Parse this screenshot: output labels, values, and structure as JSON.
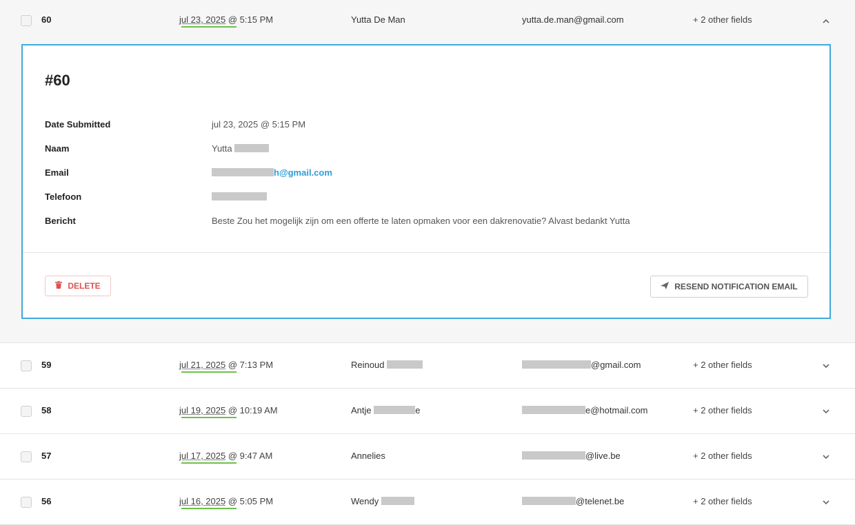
{
  "expanded": {
    "id": "60",
    "date": "jul 23, 2025",
    "time": " @ 5:15 PM",
    "name": "Yutta De Man",
    "email": "yutta.de.man@gmail.com",
    "other_fields": "+ 2 other fields",
    "detail": {
      "title": "#60",
      "fields": [
        {
          "label": "Date Submitted",
          "value": "jul 23, 2025 @ 5:15 PM"
        },
        {
          "label": "Naam",
          "value": "Yutta"
        },
        {
          "label": "Email",
          "value": "h@gmail.com"
        },
        {
          "label": "Telefoon",
          "value": ""
        },
        {
          "label": "Bericht",
          "value": "Beste Zou het mogelijk zijn om een offerte te laten opmaken voor een dakrenovatie? Alvast bedankt Yutta"
        }
      ],
      "delete_label": "DELETE",
      "resend_label": "RESEND NOTIFICATION EMAIL"
    }
  },
  "rows": [
    {
      "id": "59",
      "date": "jul 21, 2025",
      "time": " @ 7:13 PM",
      "name": "Reinoud",
      "email": "@gmail.com",
      "other_fields": "+ 2 other fields"
    },
    {
      "id": "58",
      "date": "jul 19, 2025",
      "time": " @ 10:19 AM",
      "name": "Antje",
      "name_suffix": "e",
      "email": "e@hotmail.com",
      "other_fields": "+ 2 other fields"
    },
    {
      "id": "57",
      "date": "jul 17, 2025",
      "time": " @ 9:47 AM",
      "name": "Annelies",
      "email": "@live.be",
      "other_fields": "+ 2 other fields"
    },
    {
      "id": "56",
      "date": "jul 16, 2025",
      "time": " @ 5:05 PM",
      "name": "Wendy",
      "email": "@telenet.be",
      "other_fields": "+ 2 other fields"
    }
  ],
  "colors": {
    "accent_border": "#3fa9dd",
    "link": "#2e9ed8",
    "date_underline": "#6cc04a",
    "delete": "#e05050"
  },
  "icons": {
    "expanded_row": "chevron-up-icon",
    "collapsed_row": "chevron-down-icon",
    "delete": "trash-icon",
    "resend": "paper-plane-icon"
  }
}
